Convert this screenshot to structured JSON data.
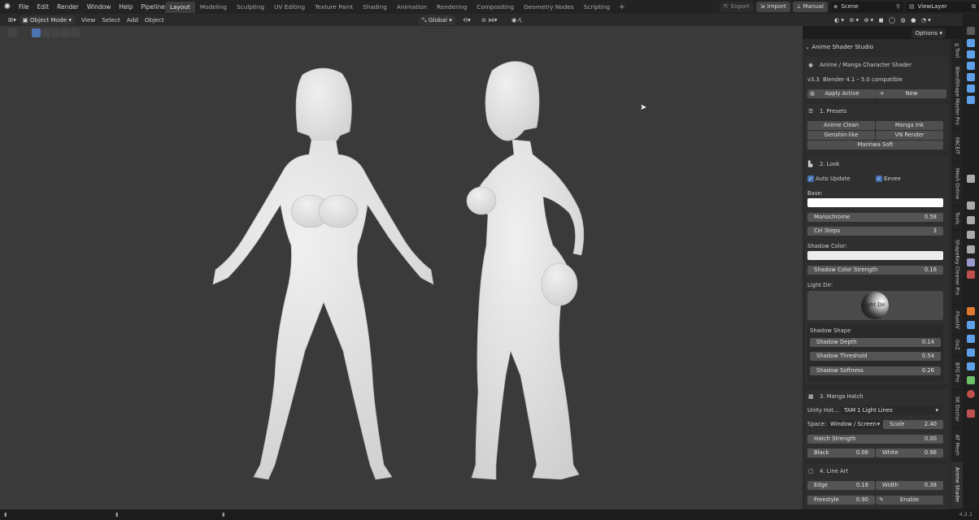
{
  "menus": [
    "File",
    "Edit",
    "Render",
    "Window",
    "Help",
    "Pipeline"
  ],
  "workspaces": [
    "Layout",
    "Modeling",
    "Sculpting",
    "UV Editing",
    "Texture Paint",
    "Shading",
    "Animation",
    "Rendering",
    "Compositing",
    "Geometry Nodes",
    "Scripting"
  ],
  "topright": {
    "export": "Export",
    "import": "Import",
    "manual": "Manual",
    "scene": "Scene",
    "viewlayer": "ViewLayer"
  },
  "header": {
    "mode": "Object Mode",
    "view": "View",
    "select": "Select",
    "add": "Add",
    "object": "Object",
    "orientation": "Global",
    "options": "Options"
  },
  "panel": {
    "addon_title": "Anime Shader Studio",
    "shader_name": "Anime / Manga Character Shader",
    "version": "v3.3",
    "compat": "Blender 4.1 – 5.0 compatible",
    "apply_active": "Apply Active",
    "new_label": "New",
    "presets": {
      "title": "1. Presets",
      "items": [
        "Anime Clean",
        "Manga Ink",
        "Genshin-like",
        "VN Render",
        "Manhwa Soft"
      ]
    },
    "look": {
      "title": "2. Look",
      "auto_update": "Auto Update",
      "eevee": "Eevee",
      "base_label": "Base:",
      "base_color": "#ffffff",
      "monochrome_label": "Monochrome",
      "monochrome": "0.58",
      "cel_steps_label": "Cel Steps",
      "cel_steps": "3",
      "shadow_color_label": "Shadow Color:",
      "shadow_color": "#ececec",
      "shadow_strength_label": "Shadow Color Strength",
      "shadow_strength": "0.16",
      "light_dir_label": "Light Dir:",
      "light_ball_text": "Light Dir",
      "shadow_shape_label": "Shadow Shape",
      "shadow_depth_label": "Shadow Depth",
      "shadow_depth": "0.14",
      "shadow_threshold_label": "Shadow Threshold",
      "shadow_threshold": "0.54",
      "shadow_softness_label": "Shadow Softness",
      "shadow_softness": "0.26"
    },
    "hatch": {
      "title": "3. Manga Hatch",
      "unity_label": "Unity Hat...",
      "unity_value": "TAM 1 Light Lines",
      "space_label": "Space:",
      "space_value": "Window / Screen",
      "scale_label": "Scale",
      "scale": "2.40",
      "strength_label": "Hatch Strength",
      "strength": "0.00",
      "black_label": "Black",
      "black": "0.06",
      "white_label": "White",
      "white": "0.96"
    },
    "lineart": {
      "title": "4. Line Art",
      "edge_label": "Edge",
      "edge": "0.18",
      "width_label": "Width",
      "width": "0.38",
      "freestyle_label": "Freestyle",
      "freestyle": "0.90",
      "enable": "Enable"
    }
  },
  "vtabs": [
    "g Tool",
    "BlendShape Master Pro",
    "FACEIT",
    "Mesh Online",
    "Tools",
    "ShapeKey Cleaner Pro",
    "FluxUV",
    "GoZ",
    "BTG Pro",
    "SK Doctor",
    "AT Mesh",
    "Anime Shader"
  ],
  "version_label": "4.2.1",
  "colors": {
    "accent": "#4772b3",
    "viewport": "#3a3a3a",
    "figure": "#dedede"
  }
}
